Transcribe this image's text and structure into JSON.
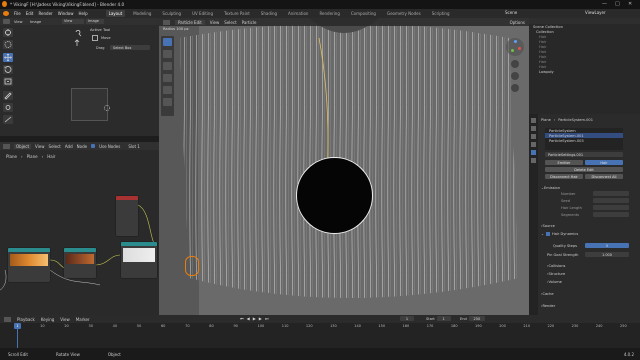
{
  "window": {
    "title": "* VikingF [H:\\Jadess Viking\\VikingF.blend] - Blender 4.0",
    "controls": [
      "—",
      "□",
      "✕"
    ]
  },
  "menubar": {
    "menus": [
      "File",
      "Edit",
      "Render",
      "Window",
      "Help"
    ],
    "workspaces": [
      "Layout",
      "Modeling",
      "Sculpting",
      "UV Editing",
      "Texture Paint",
      "Shading",
      "Animation",
      "Rendering",
      "Compositing",
      "Geometry Nodes",
      "Scripting"
    ],
    "active_workspace": "Layout",
    "scene": "Scene",
    "view_layer": "ViewLayer"
  },
  "image_editor": {
    "header": [
      "View",
      "Image",
      "View",
      "Image"
    ],
    "active_tool_title": "Active Tool",
    "tool_name": "Move",
    "drag_label": "Drag",
    "drag_value": "Select Box"
  },
  "node_editor": {
    "header": [
      "Object",
      "View",
      "Select",
      "Add",
      "Node",
      "Use Nodes",
      "Slot 1"
    ],
    "breadcrumb": [
      "Plane",
      "Plane",
      "Hair"
    ]
  },
  "viewport": {
    "mode": "Particle Edit",
    "menus": [
      "View",
      "Select",
      "Particle"
    ],
    "options": "Options",
    "sub_label": "Radius  100 px"
  },
  "outliner": {
    "title": "Scene Collection",
    "items": [
      {
        "label": "Collection",
        "selected": false
      },
      {
        "label": "Hair",
        "selected": false
      },
      {
        "label": "Hair",
        "selected": false
      },
      {
        "label": "Hair",
        "selected": false
      },
      {
        "label": "Hair",
        "selected": false
      },
      {
        "label": "Hair",
        "selected": false
      },
      {
        "label": "Hair",
        "selected": false
      },
      {
        "label": "Hair",
        "selected": false
      },
      {
        "label": "Lowpoly",
        "selected": false
      }
    ]
  },
  "properties": {
    "object": "Plane",
    "system": "ParticleSystem.001",
    "systems": [
      {
        "label": "ParticleSystem",
        "selected": false
      },
      {
        "label": "ParticleSystem.001",
        "selected": true
      },
      {
        "label": "ParticleSystem.003",
        "selected": false
      }
    ],
    "settings_label": "ParticleSettings.001",
    "type_buttons": [
      "Emitter",
      "Hair"
    ],
    "delete_edit": "Delete Edit",
    "disconnect_hair": "Disconnect Hair",
    "disconnect_all": "Disconnect All",
    "emission": "Emission",
    "emission_rows": [
      "Number",
      "Seed",
      "Hair Length",
      "Segments"
    ],
    "source": "Source",
    "hair_dynamics": "Hair Dynamics",
    "quality_steps_label": "Quality Steps",
    "quality_steps_value": "5",
    "pin_goal_label": "Pin Goal Strength",
    "pin_goal_value": "1.000",
    "sections": [
      "Collisions",
      "Structure",
      "Volume",
      "Cache",
      "Render"
    ]
  },
  "timeline": {
    "menus": [
      "Playback",
      "Keying",
      "View",
      "Marker"
    ],
    "current_frame": "1",
    "start_label": "Start",
    "start_value": "1",
    "end_label": "End",
    "end_value": "250",
    "ticks": [
      "1",
      "10",
      "20",
      "30",
      "40",
      "50",
      "60",
      "70",
      "80",
      "90",
      "100",
      "110",
      "120",
      "130",
      "140",
      "150",
      "160",
      "170",
      "180",
      "190",
      "200",
      "210",
      "220",
      "230",
      "240",
      "250"
    ]
  },
  "statusbar": {
    "items": [
      "Scroll Edit",
      "Rotate View",
      "Object"
    ],
    "version": "4.0.2"
  },
  "colors": {
    "accent": "#4772b3",
    "node_orange": "#c36b20",
    "node_teal": "#2a8c8c",
    "node_red": "#a83232"
  }
}
